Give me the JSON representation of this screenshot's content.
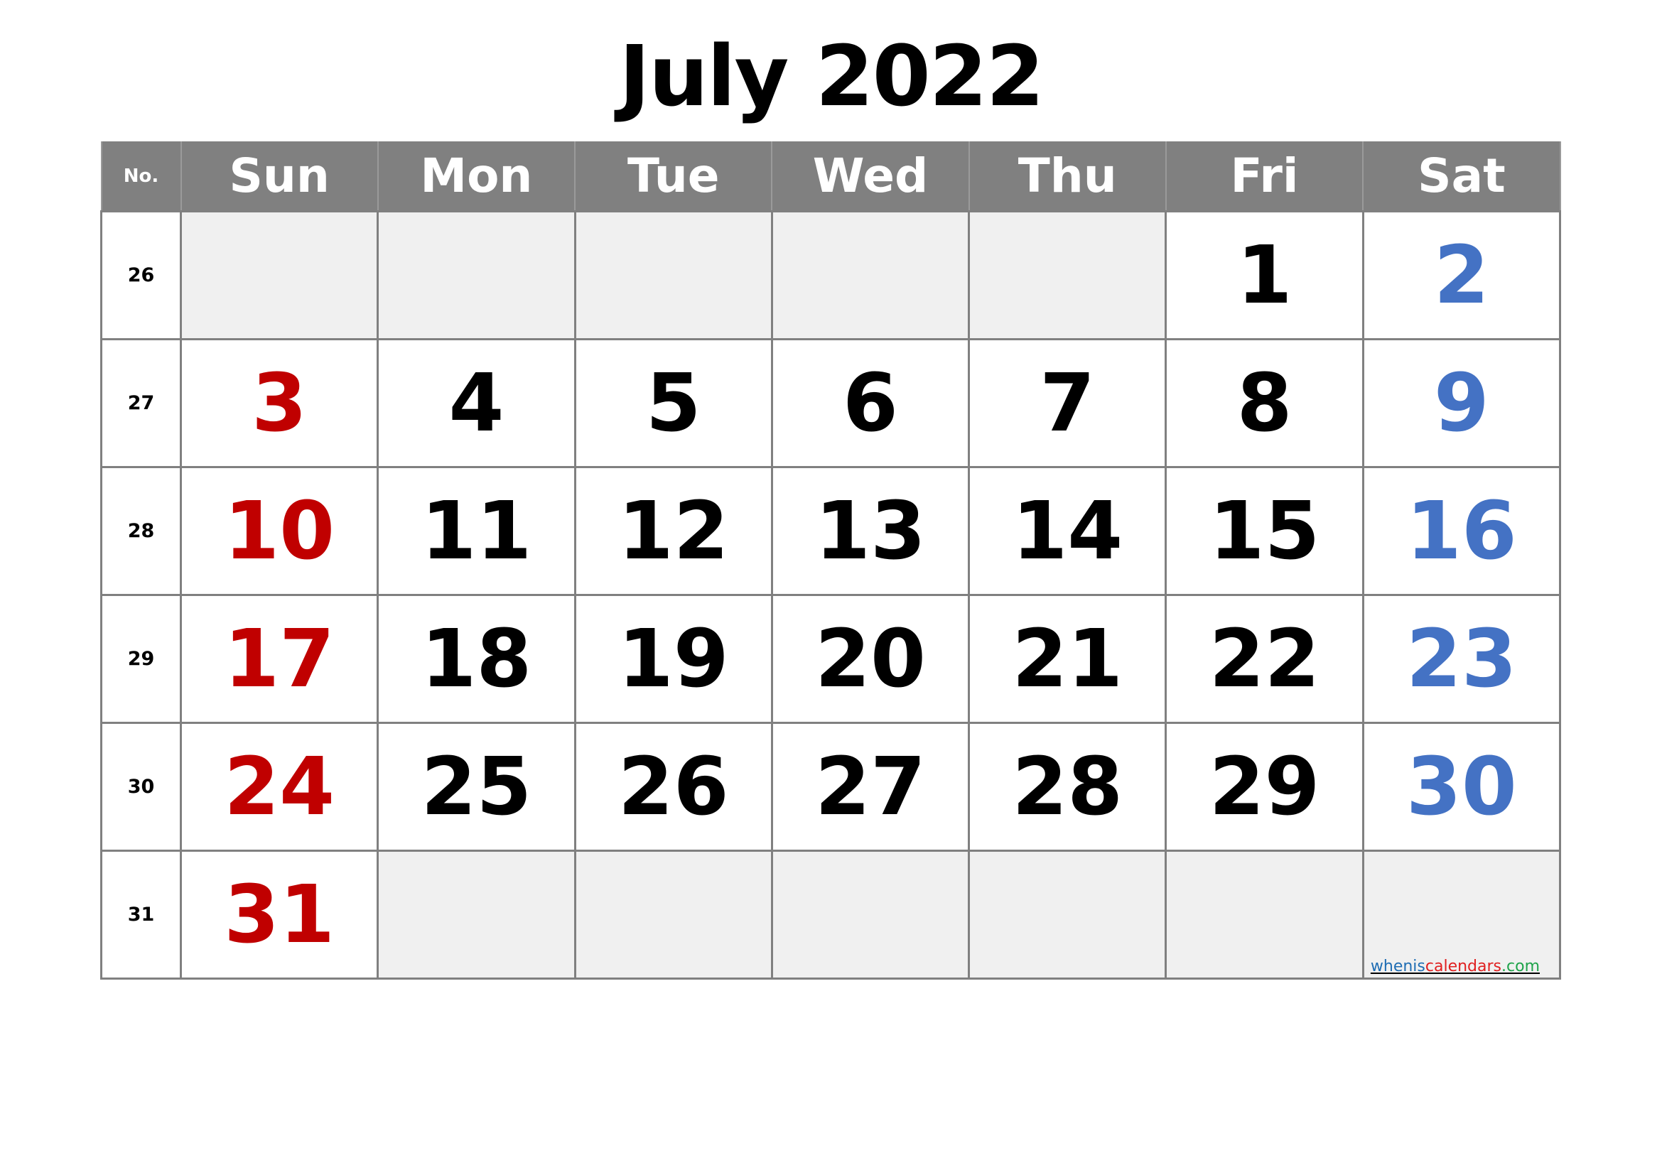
{
  "title": "July 2022",
  "header": {
    "no_label": "No.",
    "days": [
      "Sun",
      "Mon",
      "Tue",
      "Wed",
      "Thu",
      "Fri",
      "Sat"
    ]
  },
  "colors": {
    "sunday": "#c00000",
    "saturday": "#4472c4",
    "header_bg": "#808080",
    "empty_cell": "#f0f0f0"
  },
  "weeks": [
    {
      "no": "26",
      "days": [
        "",
        "",
        "",
        "",
        "",
        "1",
        "2"
      ]
    },
    {
      "no": "27",
      "days": [
        "3",
        "4",
        "5",
        "6",
        "7",
        "8",
        "9"
      ]
    },
    {
      "no": "28",
      "days": [
        "10",
        "11",
        "12",
        "13",
        "14",
        "15",
        "16"
      ]
    },
    {
      "no": "29",
      "days": [
        "17",
        "18",
        "19",
        "20",
        "21",
        "22",
        "23"
      ]
    },
    {
      "no": "30",
      "days": [
        "24",
        "25",
        "26",
        "27",
        "28",
        "29",
        "30"
      ]
    },
    {
      "no": "31",
      "days": [
        "31",
        "",
        "",
        "",
        "",
        "",
        ""
      ]
    }
  ],
  "watermark": {
    "part1": "whenis",
    "part2": "calendars",
    "part3": ".com"
  }
}
